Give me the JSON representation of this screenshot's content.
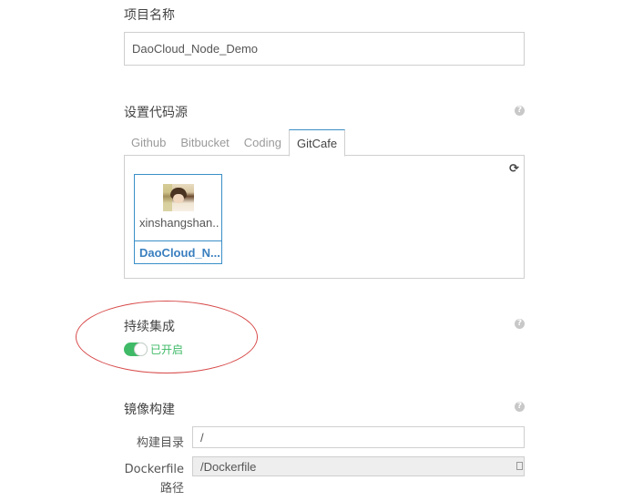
{
  "project": {
    "name_label": "项目名称",
    "name_value": "DaoCloud_Node_Demo"
  },
  "source": {
    "label": "设置代码源",
    "help": "?",
    "tabs": [
      {
        "label": "Github",
        "active": false
      },
      {
        "label": "Bitbucket",
        "active": false
      },
      {
        "label": "Coding",
        "active": false
      },
      {
        "label": "GitCafe",
        "active": true
      }
    ],
    "refresh_icon": "refresh-icon",
    "card": {
      "user": "xinshangshan...",
      "repo": "DaoCloud_N..."
    }
  },
  "ci": {
    "label": "持续集成",
    "help": "?",
    "status": "已开启",
    "enabled": true
  },
  "build": {
    "label": "镜像构建",
    "help": "?",
    "dir_label": "构建目录",
    "dir_value": "/",
    "dockerfile_label_1": "Dockerfile",
    "dockerfile_label_2": "路径",
    "dockerfile_value": "/Dockerfile"
  },
  "colors": {
    "accent": "#3a8fc8",
    "toggle_on": "#3fba67",
    "annotation": "#d84a4a"
  }
}
